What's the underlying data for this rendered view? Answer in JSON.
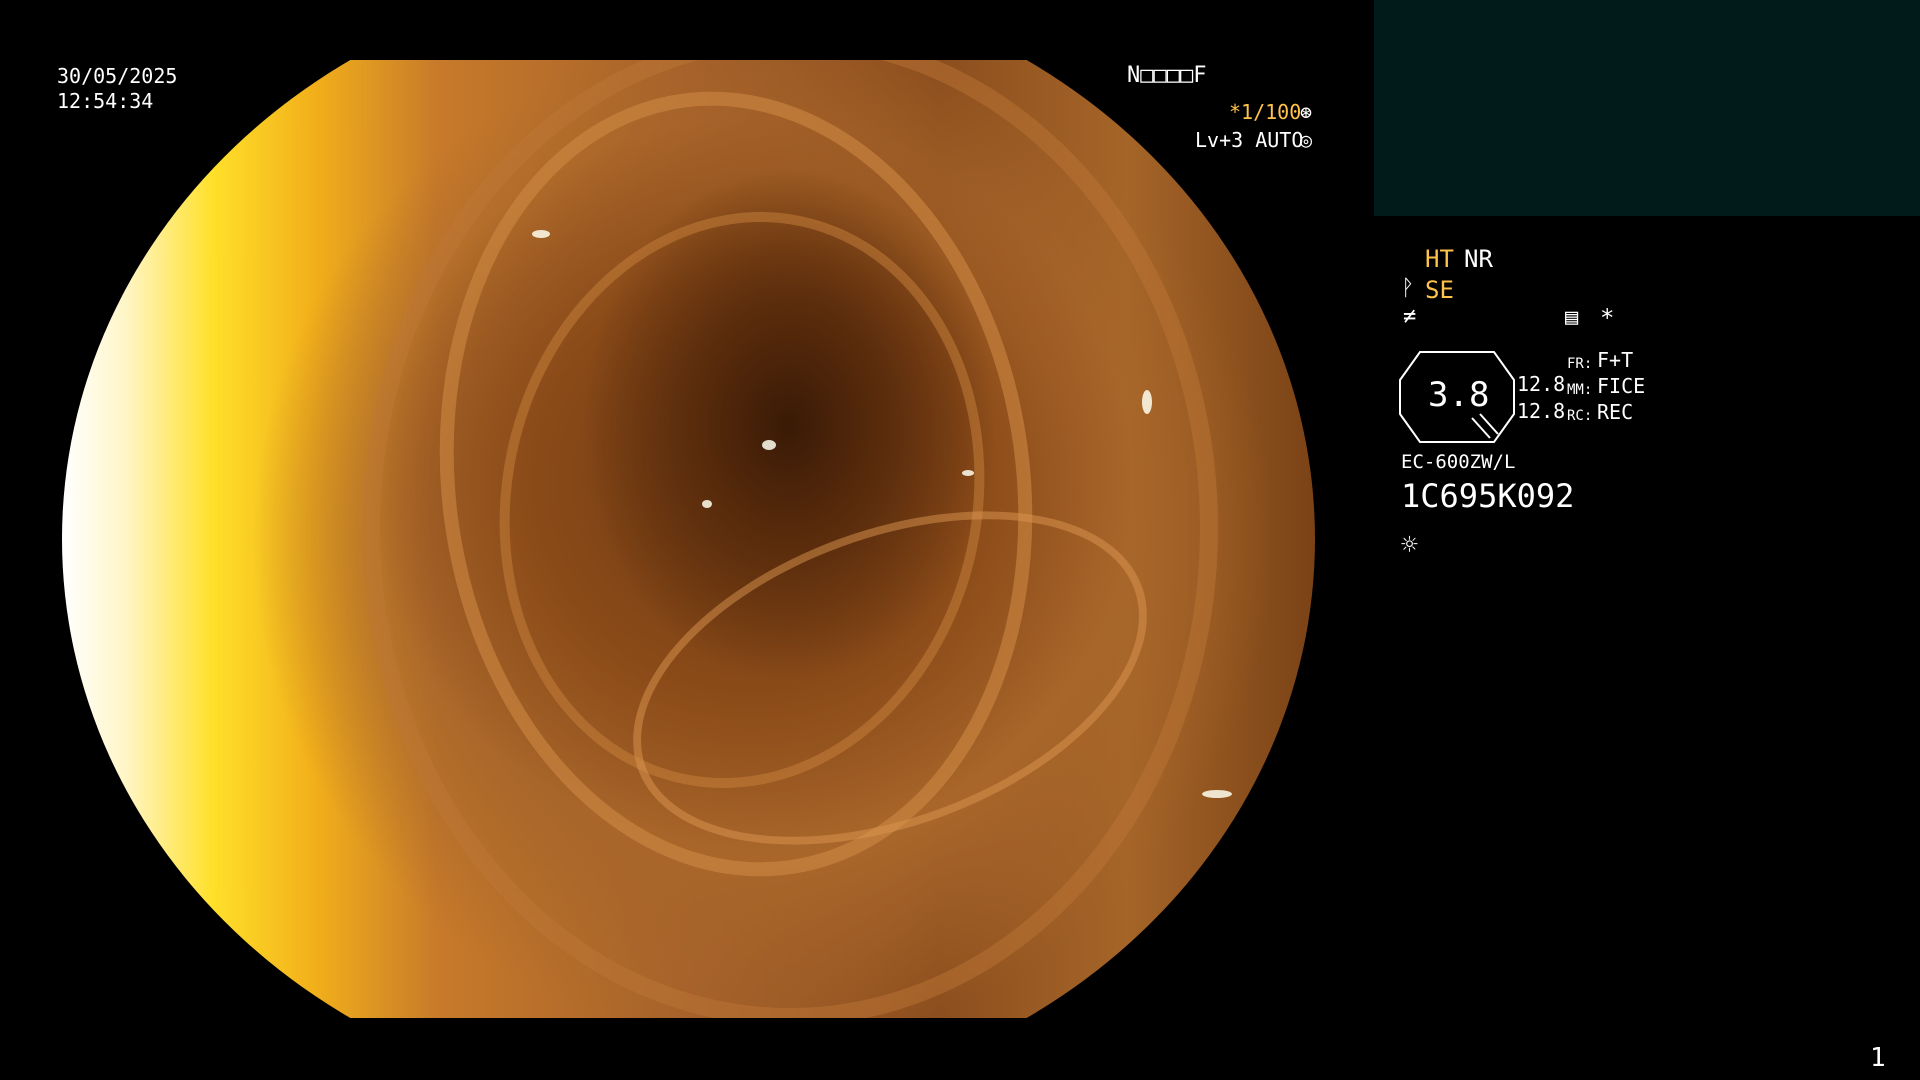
{
  "datetime": {
    "date": "30/05/2025",
    "time": "12:54:34"
  },
  "top_right_status": {
    "patient_code": "N□□□□F",
    "shutter": "*1/100",
    "level": "Lv+3 AUTO"
  },
  "side_panel": {
    "ht": "HT",
    "nr": "NR",
    "se": "SE",
    "asterisk": "*",
    "zoom_value": "3.8",
    "focus_top": "12.8",
    "focus_bottom": "12.8",
    "fr_label": "FR:",
    "fr_value": "F+T",
    "mm_label": "MM:",
    "mm_value": "FICE",
    "rc_label": "RC:",
    "rc_value": "REC",
    "scope_model": "EC-600ZW/L",
    "serial": "1C695K092"
  },
  "page_number": "1",
  "colors": {
    "accent": "#ffc24a",
    "panel_bg": "#011a1a",
    "background": "#000000"
  },
  "icons": [
    "shutter-icon",
    "auto-iris-icon",
    "scope-tip-icon",
    "lightning-icon",
    "memo-icon",
    "brightness-icon"
  ]
}
